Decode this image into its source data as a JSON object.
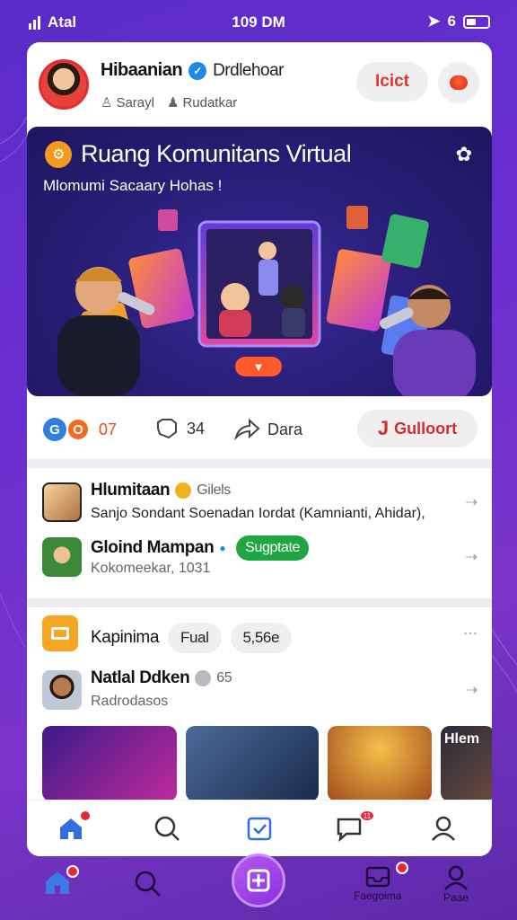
{
  "status_bar": {
    "carrier": "Atal",
    "time": "109 DM",
    "signal_icon": "signal-icon",
    "location_icon": "location-arrow-icon",
    "extra": "6"
  },
  "profile": {
    "name": "Hibaanian",
    "handle": "Drdlehoar",
    "meta_1": "Sarayl",
    "meta_2": "Rudatkar",
    "action_label": "Icict"
  },
  "banner": {
    "title": "Ruang Komunitans Virtual",
    "subtitle": "Mlomumi Sacaary Hohas !"
  },
  "actions": {
    "reactions_count": "07",
    "shares_count": "34",
    "send_label": "Dara",
    "cta_label": "Gulloort"
  },
  "feed": {
    "row1": {
      "title": "Hlumitaan",
      "meta": "Gilels",
      "desc": "Sanjo Sondant Soenadan Iordat (Kamnianti, Ahidar),"
    },
    "row2": {
      "title": "Gloind Mampan",
      "badge": "Sugptate",
      "desc": "Kokomeekar, 1031"
    }
  },
  "section2": {
    "label": "Kapinima",
    "chip1": "Fual",
    "chip2": "5,56e",
    "user": {
      "name": "Natlal Ddken",
      "count": "65",
      "desc": "Radrodasos"
    },
    "thumb_labels": [
      "",
      "",
      "",
      "Hlem"
    ]
  },
  "outer_nav": {
    "label_messages": "Faegoima",
    "label_profile": "Paae"
  },
  "colors": {
    "accent": "#6b2fd0",
    "cta_red": "#d22d2d",
    "green_badge": "#1ea641",
    "fab": "#a04ae8"
  }
}
